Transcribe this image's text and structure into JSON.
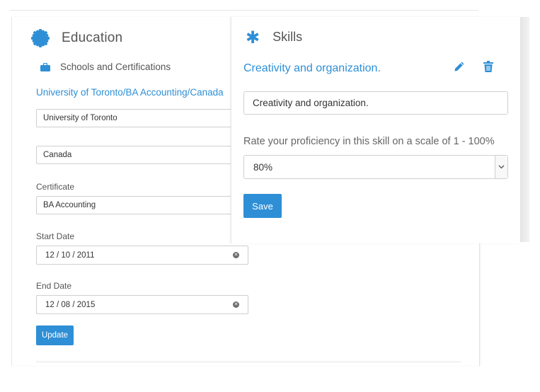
{
  "education": {
    "title": "Education",
    "icon": "gear-icon",
    "subsection": {
      "icon": "briefcase-icon",
      "label": "Schools and Certifications"
    },
    "entry_link": "University of Toronto/BA Accounting/Canada",
    "school_value": "University of Toronto",
    "country_value": "Canada",
    "certificate_label": "Certificate",
    "certificate_value": "BA Accounting",
    "start_date_label": "Start Date",
    "start_date_value": "12 / 10 / 2011",
    "end_date_label": "End Date",
    "end_date_value": "12 / 08 / 2015",
    "update_label": "Update"
  },
  "skills": {
    "title": "Skills",
    "icon": "asterisk-icon",
    "skill_name": "Creativity and organization.",
    "skill_input_value": "Creativity and organization.",
    "rate_prompt": "Rate your proficiency in this skill on a scale of 1 - 100%",
    "proficiency_value": "80%",
    "save_label": "Save"
  },
  "colors": {
    "accent": "#2e8fd6",
    "text": "#555555",
    "border": "#cfcfcf"
  }
}
